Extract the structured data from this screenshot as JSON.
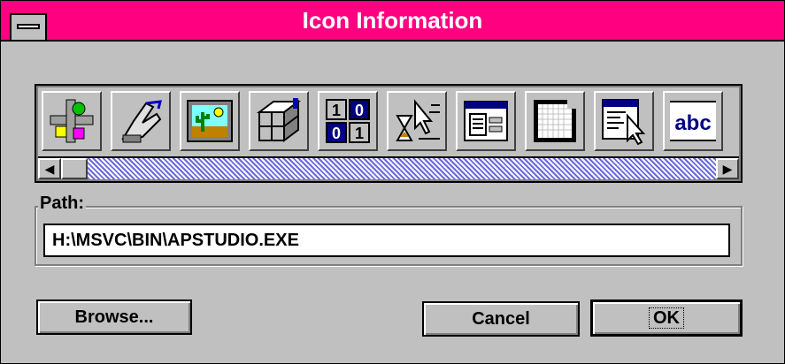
{
  "window": {
    "title": "Icon Information"
  },
  "icons": [
    {
      "name": "shapes-diagram-icon"
    },
    {
      "name": "hand-pointer-icon"
    },
    {
      "name": "desert-picture-icon"
    },
    {
      "name": "cube-grid-icon"
    },
    {
      "name": "binary-digits-icon"
    },
    {
      "name": "hourglass-cursor-icon"
    },
    {
      "name": "dialog-window-icon"
    },
    {
      "name": "grid-canvas-icon"
    },
    {
      "name": "menu-cursor-icon"
    },
    {
      "name": "text-abc-icon"
    }
  ],
  "path": {
    "label": "Path:",
    "value": "H:\\MSVC\\BIN\\APSTUDIO.EXE"
  },
  "buttons": {
    "browse": "Browse...",
    "cancel": "Cancel",
    "ok": "OK"
  },
  "colors": {
    "titlebar": "#ff0080",
    "face": "#c0c0c0",
    "scroll_track": "#6a6adc"
  }
}
